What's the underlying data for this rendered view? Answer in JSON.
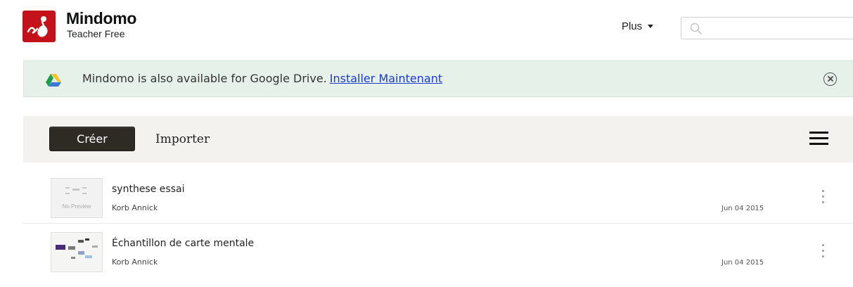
{
  "brand": {
    "name": "Mindomo",
    "plan": "Teacher Free",
    "color": "#c4121a"
  },
  "header": {
    "plus_label": "Plus",
    "search_placeholder": ""
  },
  "banner": {
    "text": "Mindomo is also available for Google Drive.",
    "link": "Installer Maintenant",
    "background": "#e6f1ea"
  },
  "toolbar": {
    "create_label": "Créer",
    "import_label": "Importer"
  },
  "documents": [
    {
      "title": "synthese essai",
      "author": "Korb Annick",
      "date": "Jun 04 2015",
      "thumbnail_text": "No Preview"
    },
    {
      "title": "Échantillon de carte mentale",
      "author": "Korb Annick",
      "date": "Jun 04 2015",
      "thumbnail_text": ""
    }
  ],
  "icons": {
    "logo": "mindomo-logo-icon",
    "caret": "chevron-down-icon",
    "search": "search-icon",
    "drive": "google-drive-icon",
    "close": "close-circle-icon",
    "menu": "hamburger-menu-icon",
    "more": "kebab-menu-icon"
  }
}
